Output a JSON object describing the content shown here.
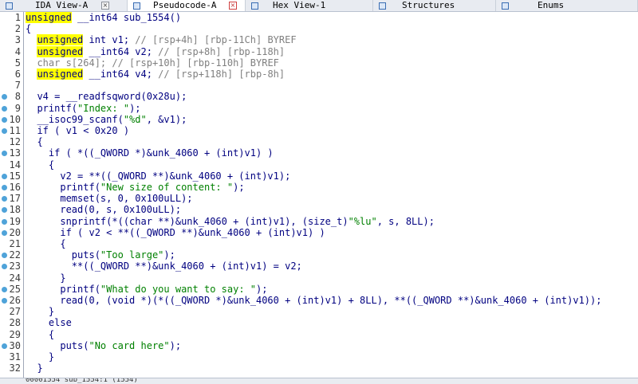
{
  "tabs": [
    {
      "label": "IDA View-A",
      "active": false,
      "icon": "ida-view-icon",
      "closable": true
    },
    {
      "label": "Pseudocode-A",
      "active": true,
      "icon": "pseudocode-icon",
      "closable": true
    },
    {
      "label": "Hex View-1",
      "active": false,
      "icon": "hex-view-icon",
      "closable": true
    },
    {
      "label": "Structures",
      "active": false,
      "icon": "structures-icon",
      "closable": true
    },
    {
      "label": "Enums",
      "active": false,
      "icon": "enums-icon",
      "closable": true
    }
  ],
  "code_lines": [
    {
      "n": "1",
      "bp": false,
      "segs": [
        [
          "kw",
          "unsigned"
        ],
        [
          "t",
          " __int64 sub_1554()"
        ]
      ]
    },
    {
      "n": "2",
      "bp": false,
      "segs": [
        [
          "t",
          "{"
        ]
      ]
    },
    {
      "n": "3",
      "bp": false,
      "segs": [
        [
          "t",
          "  "
        ],
        [
          "kw",
          "unsigned"
        ],
        [
          "t",
          " int v1; "
        ],
        [
          "cm",
          "// [rsp+4h] [rbp-11Ch] BYREF"
        ]
      ]
    },
    {
      "n": "4",
      "bp": false,
      "segs": [
        [
          "t",
          "  "
        ],
        [
          "kw",
          "unsigned"
        ],
        [
          "t",
          " __int64 v2; "
        ],
        [
          "cm",
          "// [rsp+8h] [rbp-118h]"
        ]
      ]
    },
    {
      "n": "5",
      "bp": false,
      "segs": [
        [
          "gy",
          "  char s[264]; "
        ],
        [
          "cm",
          "// [rsp+10h] [rbp-110h] BYREF"
        ]
      ]
    },
    {
      "n": "6",
      "bp": false,
      "segs": [
        [
          "t",
          "  "
        ],
        [
          "kw",
          "unsigned"
        ],
        [
          "t",
          " __int64 v4; "
        ],
        [
          "cm",
          "// [rsp+118h] [rbp-8h]"
        ]
      ]
    },
    {
      "n": "7",
      "bp": false,
      "segs": [
        [
          "t",
          ""
        ]
      ]
    },
    {
      "n": "8",
      "bp": true,
      "segs": [
        [
          "t",
          "  v4 = __readfsqword(0x28u);"
        ]
      ]
    },
    {
      "n": "9",
      "bp": true,
      "segs": [
        [
          "t",
          "  printf("
        ],
        [
          "str",
          "\"Index: \""
        ],
        [
          "t",
          ");"
        ]
      ]
    },
    {
      "n": "10",
      "bp": true,
      "segs": [
        [
          "t",
          "  __isoc99_scanf("
        ],
        [
          "str",
          "\"%d\""
        ],
        [
          "t",
          ", &v1);"
        ]
      ]
    },
    {
      "n": "11",
      "bp": true,
      "segs": [
        [
          "t",
          "  if ( v1 < 0x20 )"
        ]
      ]
    },
    {
      "n": "12",
      "bp": false,
      "segs": [
        [
          "t",
          "  {"
        ]
      ]
    },
    {
      "n": "13",
      "bp": true,
      "segs": [
        [
          "t",
          "    if ( *((_QWORD *)&unk_4060 + (int)v1) )"
        ]
      ]
    },
    {
      "n": "14",
      "bp": false,
      "segs": [
        [
          "t",
          "    {"
        ]
      ]
    },
    {
      "n": "15",
      "bp": true,
      "segs": [
        [
          "t",
          "      v2 = **((_QWORD **)&unk_4060 + (int)v1);"
        ]
      ]
    },
    {
      "n": "16",
      "bp": true,
      "segs": [
        [
          "t",
          "      printf("
        ],
        [
          "str",
          "\"New size of content: \""
        ],
        [
          "t",
          ");"
        ]
      ]
    },
    {
      "n": "17",
      "bp": true,
      "segs": [
        [
          "t",
          "      memset(s, 0, 0x100uLL);"
        ]
      ]
    },
    {
      "n": "18",
      "bp": true,
      "segs": [
        [
          "t",
          "      read(0, s, 0x100uLL);"
        ]
      ]
    },
    {
      "n": "19",
      "bp": true,
      "segs": [
        [
          "t",
          "      snprintf(*((char **)&unk_4060 + (int)v1), (size_t)"
        ],
        [
          "str",
          "\"%lu\""
        ],
        [
          "t",
          ", s, 8LL);"
        ]
      ]
    },
    {
      "n": "20",
      "bp": true,
      "segs": [
        [
          "t",
          "      if ( v2 < **((_QWORD **)&unk_4060 + (int)v1) )"
        ]
      ]
    },
    {
      "n": "21",
      "bp": false,
      "segs": [
        [
          "t",
          "      {"
        ]
      ]
    },
    {
      "n": "22",
      "bp": true,
      "segs": [
        [
          "t",
          "        puts("
        ],
        [
          "str",
          "\"Too large\""
        ],
        [
          "t",
          ");"
        ]
      ]
    },
    {
      "n": "23",
      "bp": true,
      "segs": [
        [
          "t",
          "        **((_QWORD **)&unk_4060 + (int)v1) = v2;"
        ]
      ]
    },
    {
      "n": "24",
      "bp": false,
      "segs": [
        [
          "t",
          "      }"
        ]
      ]
    },
    {
      "n": "25",
      "bp": true,
      "segs": [
        [
          "t",
          "      printf("
        ],
        [
          "str",
          "\"What do you want to say: \""
        ],
        [
          "t",
          ");"
        ]
      ]
    },
    {
      "n": "26",
      "bp": true,
      "segs": [
        [
          "t",
          "      read(0, (void *)(*((_QWORD *)&unk_4060 + (int)v1) + 8LL), **((_QWORD **)&unk_4060 + (int)v1));"
        ]
      ]
    },
    {
      "n": "27",
      "bp": false,
      "segs": [
        [
          "t",
          "    }"
        ]
      ]
    },
    {
      "n": "28",
      "bp": false,
      "segs": [
        [
          "t",
          "    else"
        ]
      ]
    },
    {
      "n": "29",
      "bp": false,
      "segs": [
        [
          "t",
          "    {"
        ]
      ]
    },
    {
      "n": "30",
      "bp": true,
      "segs": [
        [
          "t",
          "      puts("
        ],
        [
          "str",
          "\"No card here\""
        ],
        [
          "t",
          ");"
        ]
      ]
    },
    {
      "n": "31",
      "bp": false,
      "segs": [
        [
          "t",
          "    }"
        ]
      ]
    },
    {
      "n": "32",
      "bp": false,
      "segs": [
        [
          "t",
          "  }"
        ]
      ]
    }
  ],
  "status": {
    "text": "00001554 sub_1554:1 (1554)"
  },
  "colors": {
    "highlight": "#ffff00",
    "code": "#000080",
    "comment": "#808080",
    "string": "#008000",
    "breakpoint": "#4fa3d9"
  }
}
